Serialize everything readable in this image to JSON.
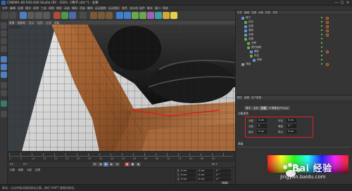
{
  "window": {
    "title": "CINEMA 4D R20.026 Studio (RC - R20) - [椅子.c4d *] - 主要",
    "controls": [
      "—",
      "□",
      "×"
    ]
  },
  "menubar": {
    "items": [
      "文件",
      "编辑",
      "创建",
      "模式",
      "选择",
      "工具",
      "网格",
      "捕捉",
      "动画",
      "模拟",
      "渲染",
      "雕刻",
      "运动跟踪",
      "运动图形",
      "角色",
      "流水线",
      "插件",
      "脚本",
      "窗口",
      "帮助"
    ]
  },
  "viewport": {
    "menu": [
      "查看",
      "摄像机",
      "显示",
      "选项",
      "过滤",
      "面板"
    ],
    "label": "透视视图",
    "accent_color": "#e02020"
  },
  "timeline": {
    "frames": [
      "0",
      "5",
      "10",
      "15",
      "20",
      "25",
      "30",
      "35",
      "40",
      "45",
      "50",
      "55",
      "60",
      "65",
      "70",
      "75",
      "80",
      "85",
      "90"
    ]
  },
  "playbar": {
    "start_frame": "0 F",
    "current_frame": "0 F",
    "end_frame": "90 F"
  },
  "materials": {
    "tabs": [
      "创建",
      "编辑",
      "功能",
      "纹理"
    ]
  },
  "coords": {
    "rows": [
      {
        "axis": "X",
        "pos": "0 cm",
        "size": "0 cm",
        "rot": "0 °"
      },
      {
        "axis": "Y",
        "pos": "0 cm",
        "size": "0 cm",
        "rot": "0 °"
      },
      {
        "axis": "Z",
        "pos": "0 cm",
        "size": "0 cm",
        "rot": "0 °"
      }
    ],
    "apply_label": "应用"
  },
  "object_manager": {
    "menu": [
      "文件",
      "编辑",
      "查看",
      "对象",
      "标签",
      "书签"
    ],
    "items": [
      {
        "label": "椅子"
      },
      {
        "label": "扶手"
      },
      {
        "label": "坐垫"
      },
      {
        "label": "靠背"
      },
      {
        "label": "支架"
      },
      {
        "label": "连接"
      },
      {
        "label": "对称"
      },
      {
        "label": "细分曲面"
      },
      {
        "label": "圆柱"
      },
      {
        "label": "挤压"
      },
      {
        "label": "样条"
      },
      {
        "label": "背景"
      }
    ]
  },
  "attribute_manager": {
    "menu": [
      "模式",
      "编辑",
      "用户数据"
    ],
    "tabs": [
      "基本",
      "坐标",
      "对象",
      "平滑着色(Phong)"
    ],
    "section": "对象属性",
    "fields": [
      {
        "label": "长度",
        "value": "0 cm"
      },
      {
        "label": "半径",
        "value": "0 cm"
      },
      {
        "label": "分段",
        "value": "0"
      },
      {
        "label": "角度",
        "value": "0 °"
      },
      {
        "label": "起点",
        "value": "0 cm"
      },
      {
        "label": "终点",
        "value": "0 cm"
      }
    ],
    "section2": "高级"
  },
  "watermark": {
    "text": "Bai 经验",
    "url": "jingyan.baidu.com"
  },
  "status": {
    "text": "移动：点击并拖动鼠标移动元素。按住 SHIFT 键量化移动。"
  }
}
